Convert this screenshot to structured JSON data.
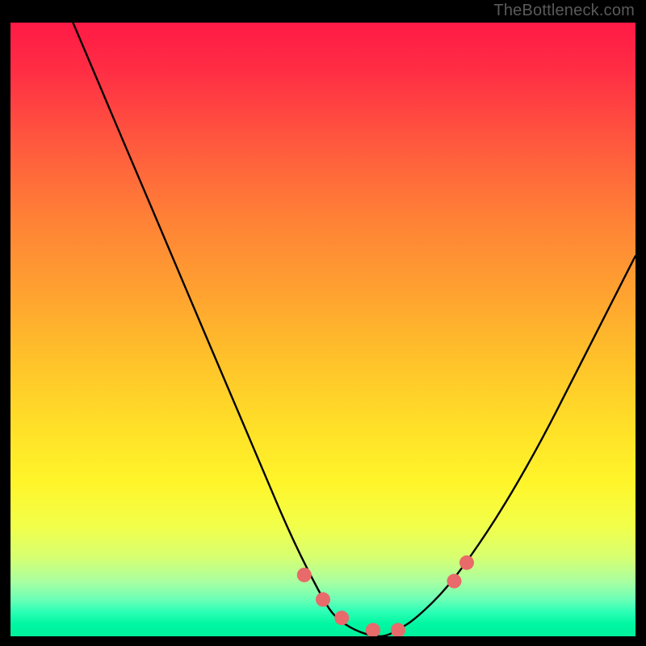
{
  "watermark": "TheBottleneck.com",
  "chart_data": {
    "type": "line",
    "title": "",
    "xlabel": "",
    "ylabel": "",
    "xlim": [
      0,
      100
    ],
    "ylim": [
      0,
      100
    ],
    "series": [
      {
        "name": "bottleneck-curve",
        "x": [
          10,
          15,
          20,
          25,
          30,
          35,
          40,
          45,
          50,
          52,
          55,
          58,
          60,
          62,
          65,
          70,
          75,
          80,
          85,
          90,
          95,
          100
        ],
        "values": [
          100,
          88,
          76,
          64,
          52,
          40,
          28,
          16,
          6,
          3,
          1,
          0,
          0,
          1,
          3,
          8,
          15,
          23,
          32,
          42,
          52,
          62
        ]
      }
    ],
    "markers": [
      {
        "name": "marker-1",
        "x": 47,
        "y": 10
      },
      {
        "name": "marker-2",
        "x": 50,
        "y": 6
      },
      {
        "name": "marker-3",
        "x": 53,
        "y": 3
      },
      {
        "name": "marker-4",
        "x": 58,
        "y": 1
      },
      {
        "name": "marker-5",
        "x": 62,
        "y": 1
      },
      {
        "name": "marker-6",
        "x": 71,
        "y": 9
      },
      {
        "name": "marker-7",
        "x": 73,
        "y": 12
      }
    ],
    "colors": {
      "curve": "#000000",
      "marker": "#e86a6a",
      "gradient_top": "#ff1a46",
      "gradient_bottom": "#00f09a"
    }
  }
}
